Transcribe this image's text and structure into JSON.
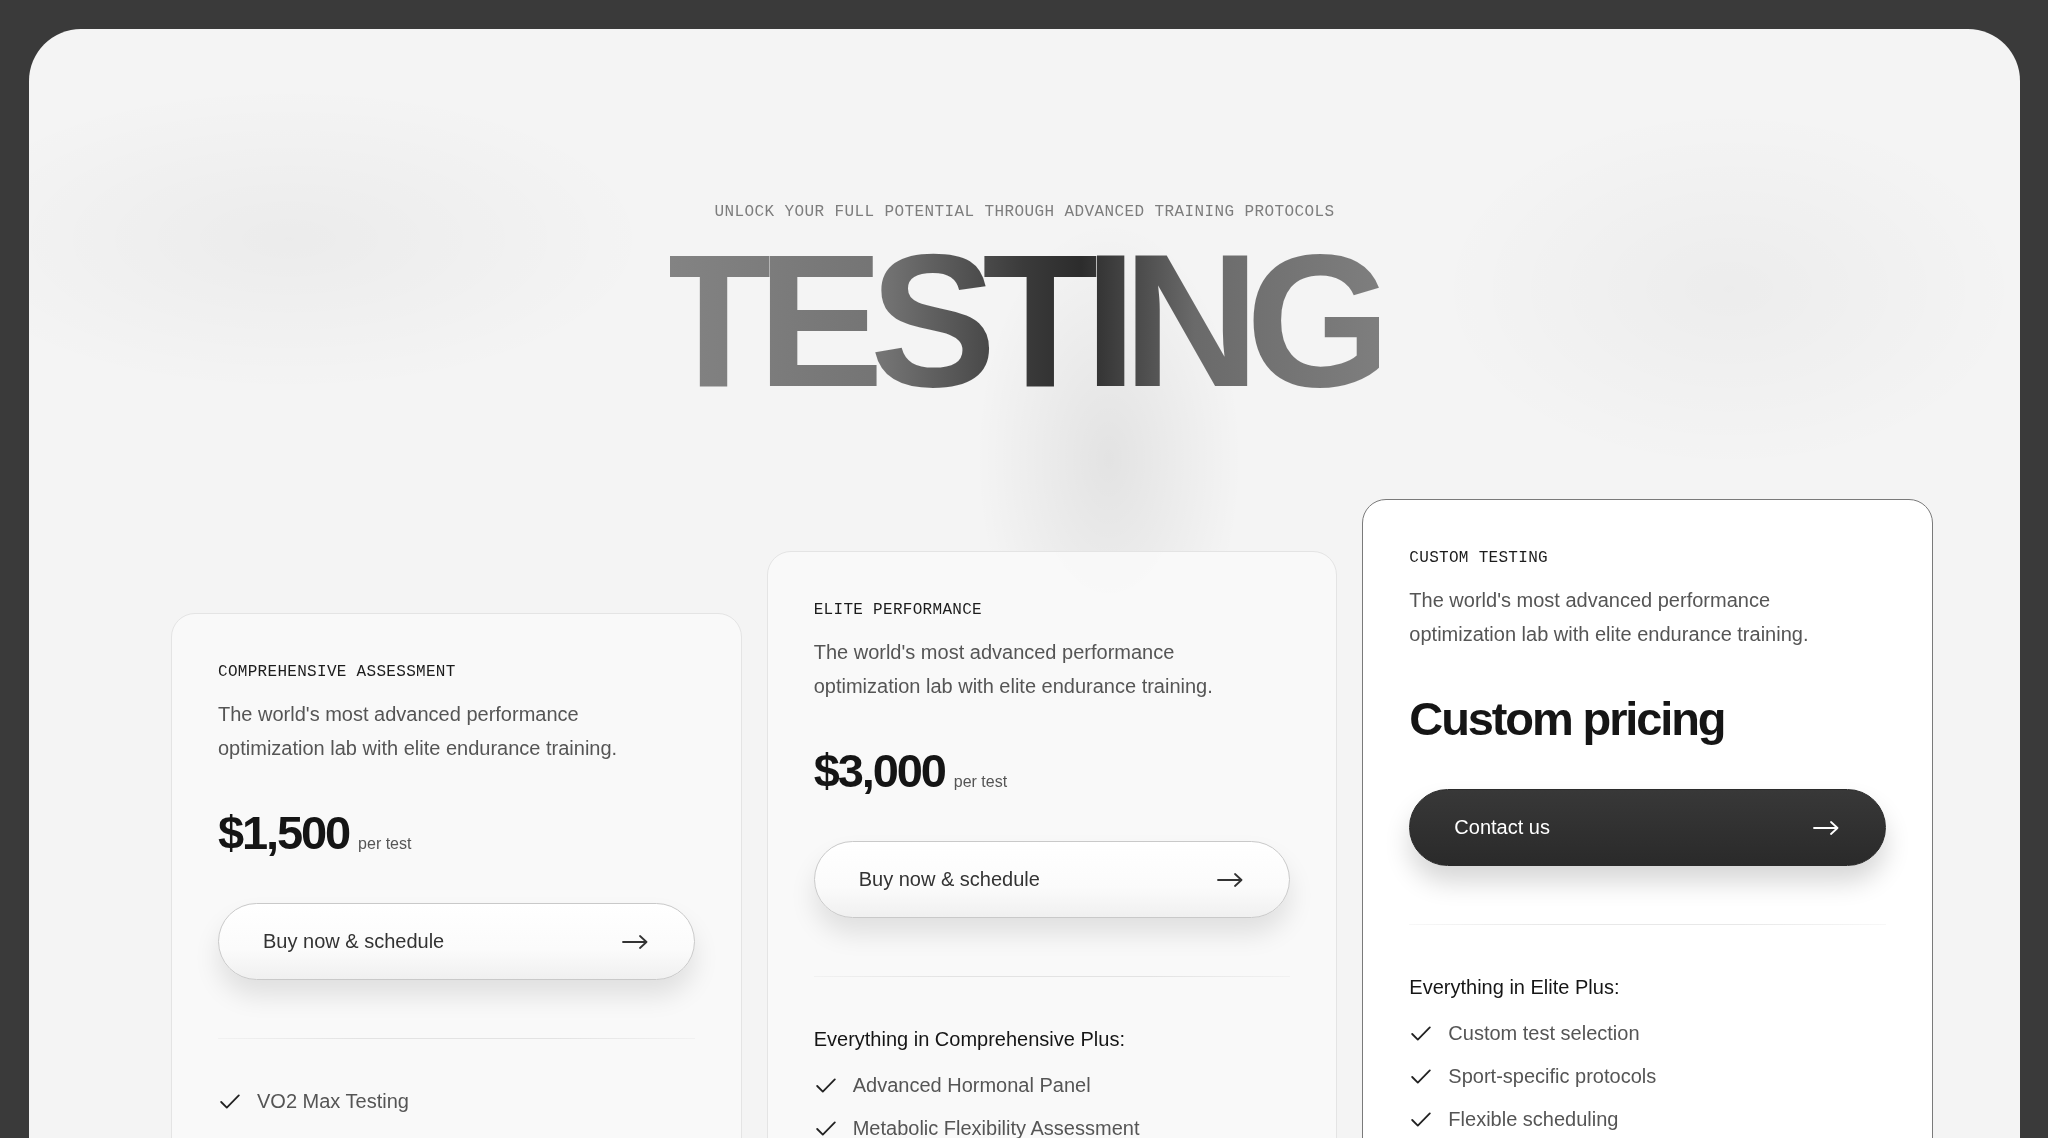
{
  "hero": {
    "eyebrow": "UNLOCK YOUR FULL POTENTIAL THROUGH ADVANCED TRAINING PROTOCOLS",
    "title": "TESTING"
  },
  "plans": [
    {
      "name": "COMPREHENSIVE ASSESSMENT",
      "description": "The world's most advanced performance optimization lab with elite endurance training.",
      "price": "$1,500",
      "price_unit": "per test",
      "highlighted": false,
      "button": {
        "label": "Buy now & schedule",
        "kind": "outline"
      },
      "features": [
        "VO2 Max Testing"
      ]
    },
    {
      "name": "ELITE PERFORMANCE",
      "description": "The world's most advanced performance optimization lab with elite endurance training.",
      "price": "$3,000",
      "price_unit": "per test",
      "highlighted": false,
      "button": {
        "label": "Buy now & schedule",
        "kind": "outline"
      },
      "features_heading": "Everything in Comprehensive Plus:",
      "features": [
        "Advanced Hormonal Panel",
        "Metabolic Flexibility Assessment"
      ]
    },
    {
      "name": "CUSTOM TESTING",
      "description": "The world's most advanced performance optimization lab with elite endurance training.",
      "price": "Custom pricing",
      "highlighted": true,
      "button": {
        "label": "Contact us",
        "kind": "solid"
      },
      "features_heading": "Everything in Elite Plus:",
      "features": [
        "Custom test selection",
        "Sport-specific protocols",
        "Flexible scheduling"
      ]
    }
  ]
}
